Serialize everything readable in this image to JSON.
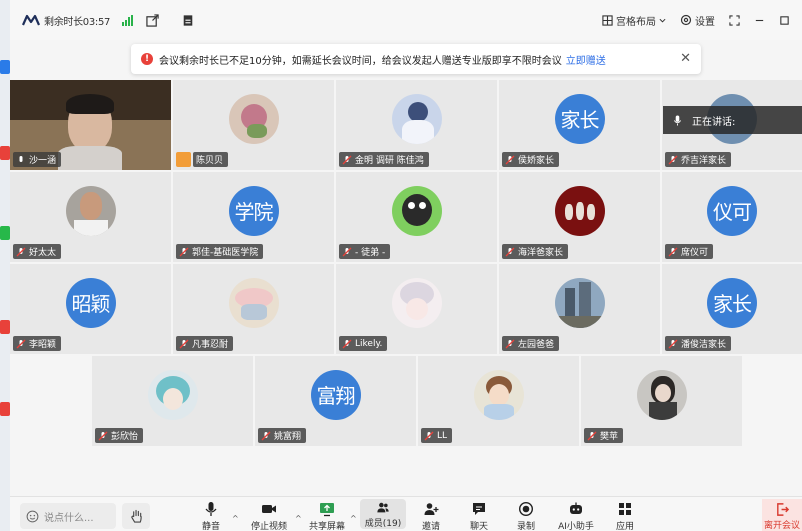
{
  "topbar": {
    "remaining_label": "剩余时长03:57",
    "layout_label": "宫格布局",
    "settings_label": "设置"
  },
  "notice": {
    "message": "会议剩余时长已不足10分钟，如需延长会议时间，给会议发起人赠送专业版即享不限时会议",
    "link": "立即赠送"
  },
  "speaking": {
    "label": "正在讲话:"
  },
  "participants": [
    {
      "name": "沙一涵",
      "avatar_text": ""
    },
    {
      "name": "陈贝贝",
      "avatar_text": ""
    },
    {
      "name": "金明 调研 陈佳鸿",
      "avatar_text": ""
    },
    {
      "name": "侯娇家长",
      "avatar_text": "家长"
    },
    {
      "name": "乔吉洋家长",
      "avatar_text": ""
    },
    {
      "name": "好太太",
      "avatar_text": ""
    },
    {
      "name": "郭佳-基础医学院",
      "avatar_text": "学院"
    },
    {
      "name": "- 徒弟 -",
      "avatar_text": ""
    },
    {
      "name": "海洋爸家长",
      "avatar_text": ""
    },
    {
      "name": "席仪可",
      "avatar_text": "仪可"
    },
    {
      "name": "李昭颖",
      "avatar_text": "昭颖"
    },
    {
      "name": "凡事忍耐",
      "avatar_text": ""
    },
    {
      "name": "Likely.",
      "avatar_text": ""
    },
    {
      "name": "左园爸爸",
      "avatar_text": ""
    },
    {
      "name": "潘俊洁家长",
      "avatar_text": "家长"
    },
    {
      "name": "彭欣怡",
      "avatar_text": ""
    },
    {
      "name": "姚富翔",
      "avatar_text": "富翔"
    },
    {
      "name": "LL",
      "avatar_text": ""
    },
    {
      "name": "樊苹",
      "avatar_text": ""
    }
  ],
  "toolbar": {
    "chat_placeholder": "说点什么...",
    "mute": "静音",
    "stop_video": "停止视频",
    "share": "共享屏幕",
    "members": "成员(19)",
    "invite": "邀请",
    "chat": "聊天",
    "record": "录制",
    "ai": "AI小助手",
    "apps": "应用",
    "leave": "离开会议"
  },
  "colors": {
    "accent": "#3a7fd6",
    "signal": "#29b24a",
    "warning": "#e8413a",
    "leave": "#d93a2f"
  }
}
